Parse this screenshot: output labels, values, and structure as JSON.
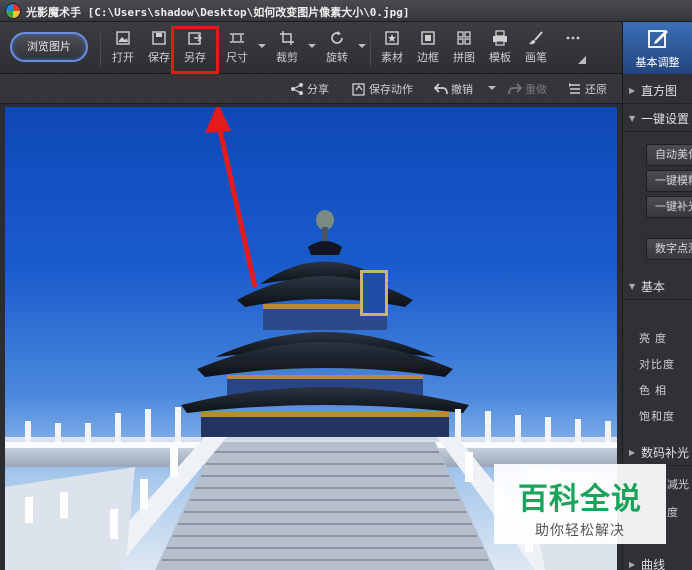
{
  "window": {
    "app_name": "光影魔术手",
    "file_path": "[C:\\Users\\shadow\\Desktop\\如何改变图片像素大小\\0.jpg]"
  },
  "toolbar": {
    "browse_label": "浏览图片",
    "buttons": [
      {
        "id": "open",
        "label": "打开",
        "icon": "open-image-icon"
      },
      {
        "id": "save",
        "label": "保存",
        "icon": "save-icon"
      },
      {
        "id": "save_as",
        "label": "另存",
        "icon": "save-as-icon",
        "highlighted": true
      },
      {
        "id": "size",
        "label": "尺寸",
        "icon": "resize-icon",
        "dropdown": true
      },
      {
        "id": "crop",
        "label": "裁剪",
        "icon": "crop-icon",
        "dropdown": true
      },
      {
        "id": "rotate",
        "label": "旋转",
        "icon": "rotate-icon",
        "dropdown": true
      },
      {
        "id": "material",
        "label": "素材",
        "icon": "sticker-icon"
      },
      {
        "id": "border",
        "label": "边框",
        "icon": "frame-icon"
      },
      {
        "id": "collage",
        "label": "拼图",
        "icon": "grid-icon"
      },
      {
        "id": "template",
        "label": "模板",
        "icon": "print-template-icon"
      },
      {
        "id": "brush",
        "label": "画笔",
        "icon": "brush-icon"
      }
    ],
    "more_icon": "more-dots-icon",
    "highlight_color": "#e51b1b"
  },
  "right_tab": {
    "label": "基本调整",
    "icon": "adjust-edit-icon",
    "color": "#2f5fa8"
  },
  "subbar": {
    "share": "分享",
    "save_action": "保存动作",
    "undo": "撤销",
    "redo": "重做",
    "restore": "还原"
  },
  "right_panel": {
    "histogram": "直方图",
    "one_key": "一键设置",
    "one_key_buttons": [
      "自动美化",
      "一键模糊",
      "一键补光"
    ],
    "digital_point": "数字点测光",
    "basic": "基本",
    "sliders": [
      "亮度",
      "对比度",
      "色相",
      "饱和度"
    ],
    "digital_fill": "数码补光",
    "fill_sub": "减光",
    "extra": "度",
    "curve": "曲线"
  },
  "watermark": {
    "big": "百科全说",
    "small": "助你轻松解决",
    "color": "#1aa35a"
  },
  "annotation": {
    "arrow_color": "#e51b1b"
  }
}
